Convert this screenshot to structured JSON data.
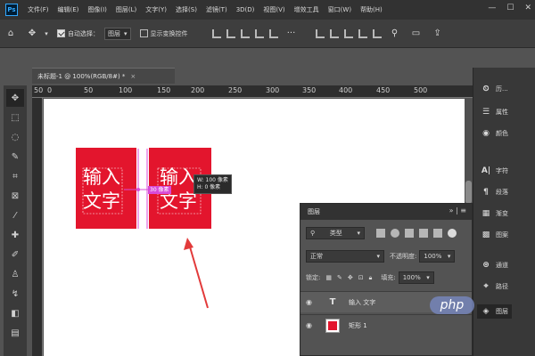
{
  "app": {
    "logo": "Ps"
  },
  "menu": [
    "文件(F)",
    "编辑(E)",
    "图像(I)",
    "图层(L)",
    "文字(Y)",
    "选择(S)",
    "滤镜(T)",
    "3D(D)",
    "视图(V)",
    "增效工具",
    "窗口(W)",
    "帮助(H)"
  ],
  "window_controls": [
    "—",
    "☐",
    "✕"
  ],
  "options": {
    "auto_select_label": "自动选择：",
    "auto_select_target": "图层",
    "show_transform_label": "显示变换控件"
  },
  "document": {
    "tab_title": "未标题-1 @ 100%(RGB/8#) *",
    "close": "×"
  },
  "ruler": {
    "ticks": [
      "50",
      "0",
      "50",
      "100",
      "150",
      "200",
      "250",
      "300",
      "350",
      "400",
      "450",
      "500"
    ]
  },
  "canvas": {
    "left_text_line1": "输入",
    "left_text_line2": "文字",
    "right_text_line1": "输入",
    "right_text_line2": "文字",
    "measure_badge": "30 像素",
    "dims_w": "W:  100 像素",
    "dims_h": "H:     0 像素",
    "colors": {
      "red": "#e3152d",
      "arrow": "#e23a3a",
      "measure": "#d84bd8"
    }
  },
  "right_panel": [
    {
      "icon": "history-icon",
      "label": "历..."
    },
    {
      "icon": "properties-icon",
      "label": "属性"
    },
    {
      "icon": "color-icon",
      "label": "颜色"
    },
    {
      "icon": "character-icon",
      "label": "字符"
    },
    {
      "icon": "paragraph-icon",
      "label": "段落"
    },
    {
      "icon": "gradient-icon",
      "label": "渐变"
    },
    {
      "icon": "pattern-icon",
      "label": "图案"
    },
    {
      "icon": "channels-icon",
      "label": "通道"
    },
    {
      "icon": "paths-icon",
      "label": "路径"
    },
    {
      "icon": "layers-icon",
      "label": "图层"
    }
  ],
  "layers_panel": {
    "tab": "图层",
    "header_controls": "» | ≡",
    "filter_label": "类型",
    "blend_mode": "正常",
    "opacity_label": "不透明度:",
    "opacity_value": "100%",
    "lock_label": "锁定:",
    "fill_label": "填充:",
    "fill_value": "100%",
    "layers": [
      {
        "type": "text",
        "thumb": "T",
        "name": "输入 文字"
      },
      {
        "type": "shape",
        "thumb": "",
        "name": "矩形 1"
      }
    ]
  },
  "watermark": "php"
}
